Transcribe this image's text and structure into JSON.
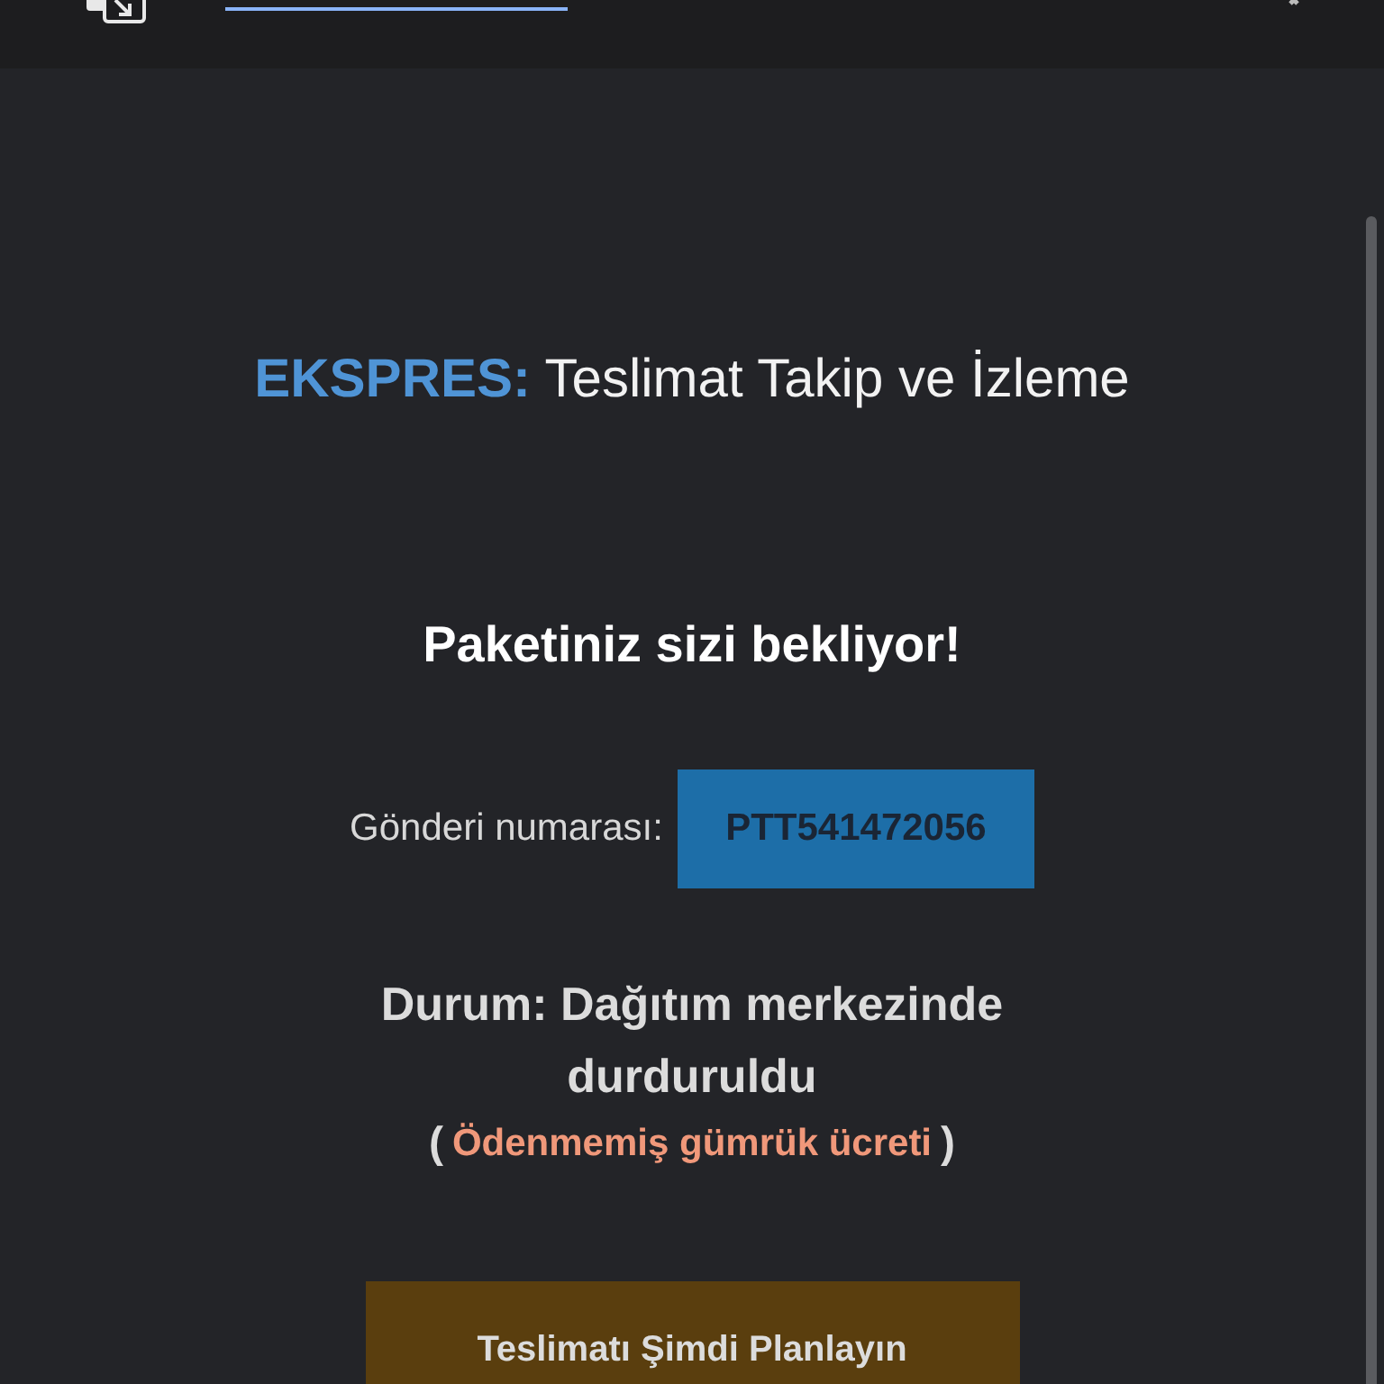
{
  "brand": {
    "name": "EKSPRES:",
    "subtitle": "Teslimat Takip ve İzleme"
  },
  "heading": "Paketiniz sizi bekliyor!",
  "tracking": {
    "label": "Gönderi numarası:",
    "number": "PTT541472056"
  },
  "status": {
    "text": "Durum: Dağıtım merkezinde durduruldu",
    "open": "(",
    "reason": "Ödenmemiş gümrük ücreti",
    "close": ")"
  },
  "button": "Teslimatı Şimdi Planlayın"
}
